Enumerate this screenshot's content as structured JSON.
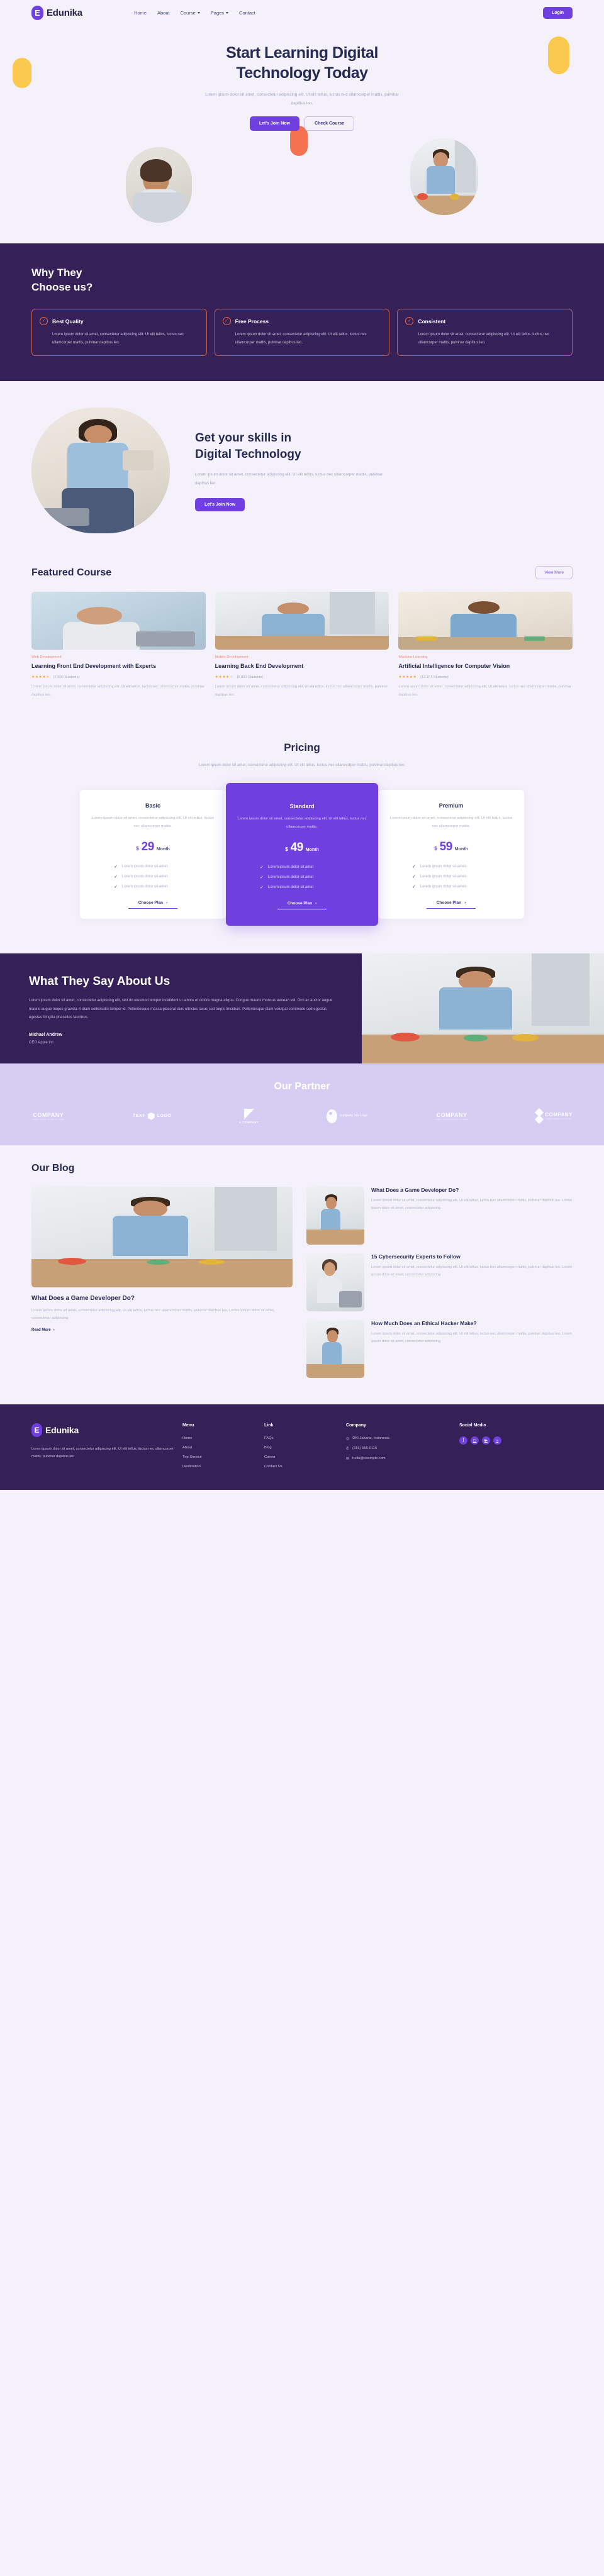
{
  "brand": {
    "name": "Edunika",
    "mark": "E"
  },
  "nav": {
    "items": [
      {
        "label": "Home",
        "active": true,
        "caret": false
      },
      {
        "label": "About",
        "active": false,
        "caret": false
      },
      {
        "label": "Course",
        "active": false,
        "caret": true
      },
      {
        "label": "Pages",
        "active": false,
        "caret": true
      },
      {
        "label": "Contact",
        "active": false,
        "caret": false
      }
    ],
    "login_label": "Login"
  },
  "hero": {
    "title_line1": "Start Learning Digital",
    "title_line2": "Technology Today",
    "subtitle": "Lorem ipsum dolor sit amet, consectetur adipiscing elit. Ut elit tellus, luctus nec ullamcorper mattis, pulvinar dapibus leo.",
    "primary_btn": "Let's Join Now",
    "secondary_btn": "Check Course"
  },
  "why": {
    "title_line1": "Why They",
    "title_line2": "Choose us?",
    "cards": [
      {
        "title": "Best Quality",
        "text": "Lorem ipsum dolor sit amet, consectetur adipiscing elit. Ut elit tellus, luctus nec ullamcorper mattis, pulvinar dapibus leo."
      },
      {
        "title": "Free Process",
        "text": "Lorem ipsum dolor sit amet, consectetur adipiscing elit. Ut elit tellus, luctus nec ullamcorper mattis, pulvinar dapibus leo."
      },
      {
        "title": "Consistent",
        "text": "Lorem ipsum dolor sit amet, consectetur adipiscing elit. Ut elit tellus, luctus nec ullamcorper mattis, pulvinar dapibus leo."
      }
    ]
  },
  "skills": {
    "title_line1": "Get your skills in",
    "title_line2": "Digital Technology",
    "text": "Lorem ipsum dolor sit amet, consectetur adipiscing elit. Ut elit tellus, luctus nec ullamcorper mattis, pulvinar dapibus leo.",
    "cta": "Let's Join Now"
  },
  "featured": {
    "title": "Featured Course",
    "view_more": "View More",
    "courses": [
      {
        "category": "Web Development",
        "title": "Learning Front End Development with Experts",
        "stars": 4.5,
        "students": "(7.500 Students)",
        "desc": "Lorem ipsum dolor sit amet, consectetur adipiscing elit. Ut elit tellus, luctus nec ullamcorper mattis, pulvinar dapibus leo."
      },
      {
        "category": "Mobile Development",
        "title": "Learning Back End Development",
        "stars": 4,
        "students": "(8.800 Students)",
        "desc": "Lorem ipsum dolor sit amet, consectetur adipiscing elit. Ut elit tellus, luctus nec ullamcorper mattis, pulvinar dapibus leo."
      },
      {
        "category": "Machine Learning",
        "title": "Artificial Intelligence for Computer Vision",
        "stars": 5,
        "students": "(12.157 Students)",
        "desc": "Lorem ipsum dolor sit amet, consectetur adipiscing elit. Ut elit tellus, luctus nec ullamcorper mattis, pulvinar dapibus leo."
      }
    ]
  },
  "pricing": {
    "title": "Pricing",
    "subtitle": "Lorem ipsum dolor sit amet, consectetur adipiscing elit. Ut elit tellus, luctus nec ullamcorper mattis, pulvinar dapibus leo.",
    "plans": [
      {
        "name": "Basic",
        "desc": "Lorem ipsum dolor sit amet, consectetur adipiscing elit. Ut elit tellus, luctus nec ullamcorper mattis.",
        "currency": "$",
        "amount": "29",
        "period": "Month",
        "features": [
          "Lorem ipsum dolor sit amet",
          "Lorem ipsum dolor sit amet",
          "Lorem ipsum dolor sit amet"
        ],
        "cta": "Choose Plan",
        "highlight": false
      },
      {
        "name": "Standard",
        "desc": "Lorem ipsum dolor sit amet, consectetur adipiscing elit. Ut elit tellus, luctus nec ullamcorper mattis.",
        "currency": "$",
        "amount": "49",
        "period": "Month",
        "features": [
          "Lorem ipsum dolor sit amet",
          "Lorem ipsum dolor sit amet",
          "Lorem ipsum dolor sit amet"
        ],
        "cta": "Choose Plan",
        "highlight": true
      },
      {
        "name": "Premium",
        "desc": "Lorem ipsum dolor sit amet, consectetur adipiscing elit. Ut elit tellus, luctus nec ullamcorper mattis.",
        "currency": "$",
        "amount": "59",
        "period": "Month",
        "features": [
          "Lorem ipsum dolor sit amet",
          "Lorem ipsum dolor sit amet",
          "Lorem ipsum dolor sit amet"
        ],
        "cta": "Choose Plan",
        "highlight": false
      }
    ]
  },
  "testimonial": {
    "title": "What They Say About Us",
    "quote": "Lorem ipsum dolor sit amet, consectetur adipiscing elit, sed do eiusmod tempor incididunt ut labore et dolore magna aliqua. Congue mauris rhoncus aenean vel. Orci ac auctor augue mauris augue neque gravida. A diam sollicitudin tempor id. Pellentesque massa placerat duis ultricies lacus sed turpis tincidunt. Pellentesque diam volutpat commodo sed egestas egestas fringilla phasellus faucibus.",
    "name": "Michael Andrew",
    "role": "CEO Apple Inc."
  },
  "partners": {
    "title": "Our Partner",
    "logos": [
      {
        "word": "COMPANY",
        "tagline": "LOREM IPSUM DOLOR SIT AMET",
        "style": "word"
      },
      {
        "word": "TEXT LOGO",
        "tagline": "",
        "style": "hex"
      },
      {
        "word": "A COMPANY",
        "tagline": "",
        "style": "triangle"
      },
      {
        "word": "Company Text Logo",
        "tagline": "",
        "style": "circle"
      },
      {
        "word": "COMPANY",
        "tagline": "LOREM IPSUM DOLOR SIT AMET",
        "style": "word"
      },
      {
        "word": "COMPANY",
        "tagline": "LOREM IPSUM DOLOR SIT",
        "style": "diamond"
      }
    ]
  },
  "blog": {
    "title": "Our Blog",
    "main": {
      "title": "What Does a Game Developer Do?",
      "desc": "Lorem ipsum dolor sit amet, consectetur adipiscing elit. Ut elit tellus, luctus nec ullamcorper mattis, pulvinar dapibus leo. Lorem ipsum dolor sit amet, consectetur adipiscing",
      "read_more": "Read More"
    },
    "items": [
      {
        "title": "What Does a Game Developer Do?",
        "desc": "Lorem ipsum dolor sit amet, consectetur adipiscing elit. Ut elit tellus, luctus nec ullamcorper mattis, pulvinar dapibus leo. Lorem ipsum dolor sit amet, consectetur adipiscing"
      },
      {
        "title": "15 Cybersecurity Experts to Follow",
        "desc": "Lorem ipsum dolor sit amet, consectetur adipiscing elit. Ut elit tellus, luctus nec ullamcorper mattis, pulvinar dapibus leo. Lorem ipsum dolor sit amet, consectetur adipiscing"
      },
      {
        "title": "How Much Does an Ethical Hacker Make?",
        "desc": "Lorem ipsum dolor sit amet, consectetur adipiscing elit. Ut elit tellus, luctus nec ullamcorper mattis, pulvinar dapibus leo. Lorem ipsum dolor sit amet, consectetur adipiscing"
      }
    ]
  },
  "footer": {
    "about": "Lorem ipsum dolor sit amet, consectetur adipiscing elit. Ut elit tellus, luctus nec ullamcorper mattis, pulvinar dapibus leo.",
    "menu": {
      "heading": "Menu",
      "items": [
        "Home",
        "About",
        "Trip Service",
        "Destination"
      ]
    },
    "link": {
      "heading": "Link",
      "items": [
        "FAQs",
        "Blog",
        "Career",
        "Contact Us"
      ]
    },
    "company": {
      "heading": "Company",
      "items": [
        {
          "icon": "location-pin-icon",
          "glyph": "◎",
          "text": "DKI Jakarta, Indonesia"
        },
        {
          "icon": "phone-icon",
          "glyph": "✆",
          "text": "(316) 555-0116"
        },
        {
          "icon": "mail-icon",
          "glyph": "✉",
          "text": "hello@example.com"
        }
      ]
    },
    "social": {
      "heading": "Social Media",
      "items": [
        {
          "name": "facebook-icon",
          "glyph": "f"
        },
        {
          "name": "instagram-icon",
          "glyph": "▢"
        },
        {
          "name": "youtube-icon",
          "glyph": "▶"
        },
        {
          "name": "linkedin-icon",
          "glyph": "in"
        }
      ]
    }
  },
  "colors": {
    "primary": "#6f3fe0",
    "dark": "#352058",
    "bg": "#f4f1fb",
    "accent_orange": "#ef6a4b",
    "accent_yellow": "#fbc950",
    "partner_bg": "#d6cdf2"
  }
}
